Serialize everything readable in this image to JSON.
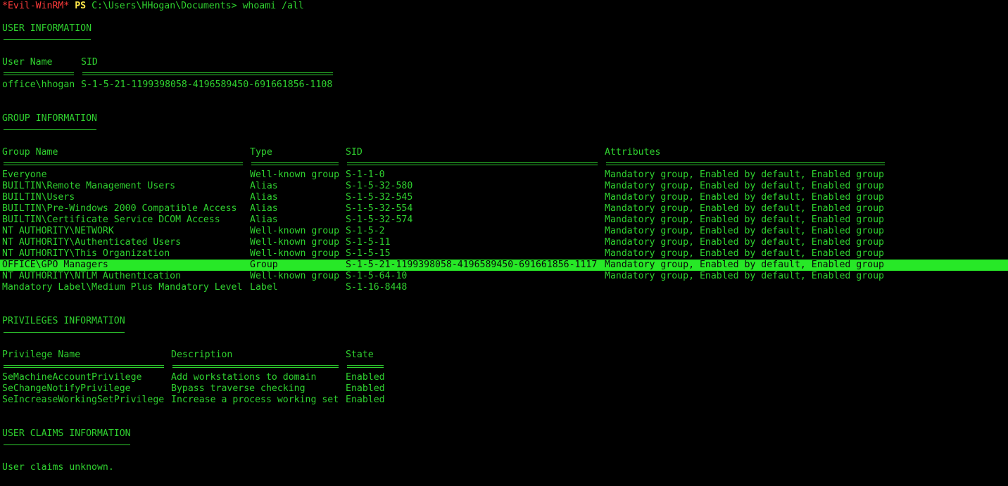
{
  "prompt": {
    "shell_tag": "*Evil-WinRM*",
    "ps": "PS",
    "path": "C:\\Users\\HHogan\\Documents>",
    "command": "whoami /all"
  },
  "user_info": {
    "heading": "USER INFORMATION",
    "columns": [
      "User Name",
      "SID"
    ],
    "row": {
      "user_name": "office\\hhogan",
      "sid": "S-1-5-21-1199398058-4196589450-691661856-1108"
    }
  },
  "group_info": {
    "heading": "GROUP INFORMATION",
    "columns": [
      "Group Name",
      "Type",
      "SID",
      "Attributes"
    ],
    "rows": [
      {
        "name": "Everyone",
        "type": "Well-known group",
        "sid": "S-1-1-0",
        "attributes": "Mandatory group, Enabled by default, Enabled group"
      },
      {
        "name": "BUILTIN\\Remote Management Users",
        "type": "Alias",
        "sid": "S-1-5-32-580",
        "attributes": "Mandatory group, Enabled by default, Enabled group"
      },
      {
        "name": "BUILTIN\\Users",
        "type": "Alias",
        "sid": "S-1-5-32-545",
        "attributes": "Mandatory group, Enabled by default, Enabled group"
      },
      {
        "name": "BUILTIN\\Pre-Windows 2000 Compatible Access",
        "type": "Alias",
        "sid": "S-1-5-32-554",
        "attributes": "Mandatory group, Enabled by default, Enabled group"
      },
      {
        "name": "BUILTIN\\Certificate Service DCOM Access",
        "type": "Alias",
        "sid": "S-1-5-32-574",
        "attributes": "Mandatory group, Enabled by default, Enabled group"
      },
      {
        "name": "NT AUTHORITY\\NETWORK",
        "type": "Well-known group",
        "sid": "S-1-5-2",
        "attributes": "Mandatory group, Enabled by default, Enabled group"
      },
      {
        "name": "NT AUTHORITY\\Authenticated Users",
        "type": "Well-known group",
        "sid": "S-1-5-11",
        "attributes": "Mandatory group, Enabled by default, Enabled group"
      },
      {
        "name": "NT AUTHORITY\\This Organization",
        "type": "Well-known group",
        "sid": "S-1-5-15",
        "attributes": "Mandatory group, Enabled by default, Enabled group"
      },
      {
        "name": "OFFICE\\GPO Managers",
        "type": "Group",
        "sid": "S-1-5-21-1199398058-4196589450-691661856-1117",
        "attributes": "Mandatory group, Enabled by default, Enabled group"
      },
      {
        "name": "NT AUTHORITY\\NTLM Authentication",
        "type": "Well-known group",
        "sid": "S-1-5-64-10",
        "attributes": "Mandatory group, Enabled by default, Enabled group"
      },
      {
        "name": "Mandatory Label\\Medium Plus Mandatory Level",
        "type": "Label",
        "sid": "S-1-16-8448",
        "attributes": ""
      }
    ],
    "highlighted_row_index": 8
  },
  "privileges_info": {
    "heading": "PRIVILEGES INFORMATION",
    "columns": [
      "Privilege Name",
      "Description",
      "State"
    ],
    "rows": [
      {
        "name": "SeMachineAccountPrivilege",
        "description": "Add workstations to domain",
        "state": "Enabled"
      },
      {
        "name": "SeChangeNotifyPrivilege",
        "description": "Bypass traverse checking",
        "state": "Enabled"
      },
      {
        "name": "SeIncreaseWorkingSetPrivilege",
        "description": "Increase a process working set",
        "state": "Enabled"
      }
    ]
  },
  "claims_info": {
    "heading": "USER CLAIMS INFORMATION",
    "message": "User claims unknown."
  },
  "colors": {
    "background": "#000000",
    "text": "#2fd12f",
    "evil_tag": "#ff3b3b",
    "ps_tag": "#ffe84a",
    "highlight": "#27e827"
  }
}
